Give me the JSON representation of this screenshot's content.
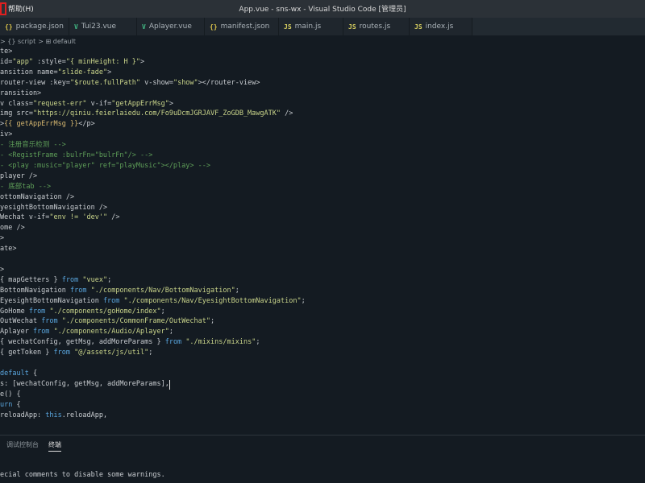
{
  "window": {
    "help_menu": "帮助(H)",
    "title": "App.vue - sns-wx - Visual Studio Code [管理员]"
  },
  "tabs": [
    {
      "icon": "{}",
      "label": "package.json"
    },
    {
      "icon": "V",
      "label": "Tui23.vue"
    },
    {
      "icon": "V",
      "label": "Aplayer.vue"
    },
    {
      "icon": "{}",
      "label": "manifest.json"
    },
    {
      "icon": "JS",
      "label": "main.js"
    },
    {
      "icon": "JS",
      "label": "routes.js"
    },
    {
      "icon": "JS",
      "label": "index.js"
    }
  ],
  "breadcrumb": {
    "items": [
      "> {} script",
      "> ⊞ default"
    ]
  },
  "code": [
    {
      "t": "te>"
    },
    {
      "t": "id=\"app\" :style=\"{ minHeight: H }\">"
    },
    {
      "t": "ansition name=\"slide-fade\">"
    },
    {
      "t": "router-view :key=\"$route.fullPath\" v-show=\"show\"></router-view>"
    },
    {
      "t": "ransition>"
    },
    {
      "t": "v class=\"request-err\" v-if=\"getAppErrMsg\">"
    },
    {
      "t": "img src=\"https://qiniu.feierlaiedu.com/Fo9uDcmJGRJAVF_ZoGDB_MawgATK\" />"
    },
    {
      "t": ">{{ getAppErrMsg }}</p>"
    },
    {
      "t": "iv>"
    },
    {
      "t": "- 注册音乐检测 -->"
    },
    {
      "t": "- <RegistFrame :bulrFn=\"bulrFn\"/> -->"
    },
    {
      "t": "- <play :music=\"player\" ref=\"playMusic\"></play> -->"
    },
    {
      "t": "player />"
    },
    {
      "t": "- 底部tab -->"
    },
    {
      "t": "ottomNavigation />"
    },
    {
      "t": "yesightBottomNavigation />"
    },
    {
      "t": "Wechat v-if=\"env != 'dev'\" />"
    },
    {
      "t": "ome />"
    },
    {
      "t": ">"
    },
    {
      "t": "ate>"
    },
    {
      "t": ""
    },
    {
      "t": ">"
    },
    {
      "t": "{ mapGetters } from \"vuex\";"
    },
    {
      "t": "BottomNavigation from \"./components/Nav/BottomNavigation\";"
    },
    {
      "t": "EyesightBottomNavigation from \"./components/Nav/EyesightBottomNavigation\";"
    },
    {
      "t": "GoHome from \"./components/goHome/index\";"
    },
    {
      "t": "OutWechat from \"./components/CommonFrame/OutWechat\";"
    },
    {
      "t": "Aplayer from \"./components/Audio/Aplayer\";"
    },
    {
      "t": "{ wechatConfig, getMsg, addMoreParams } from \"./mixins/mixins\";"
    },
    {
      "t": "{ getToken } from \"@/assets/js/util\";"
    },
    {
      "t": ""
    },
    {
      "t": "default {"
    },
    {
      "t": "s: [wechatConfig, getMsg, addMoreParams],"
    },
    {
      "t": "e() {"
    },
    {
      "t": "urn {"
    },
    {
      "t": "reloadApp: this.reloadApp,"
    }
  ],
  "panel": {
    "tabs": [
      "调试控制台",
      "终端"
    ],
    "active_tab": "终端",
    "terminal_line": "ecial comments to disable some warnings."
  },
  "colors": {
    "tag": "#5aa7e0",
    "attr": "#8fd0e0",
    "string": "#c9d48a",
    "comment": "#5e9e58",
    "background": "#141b22"
  }
}
